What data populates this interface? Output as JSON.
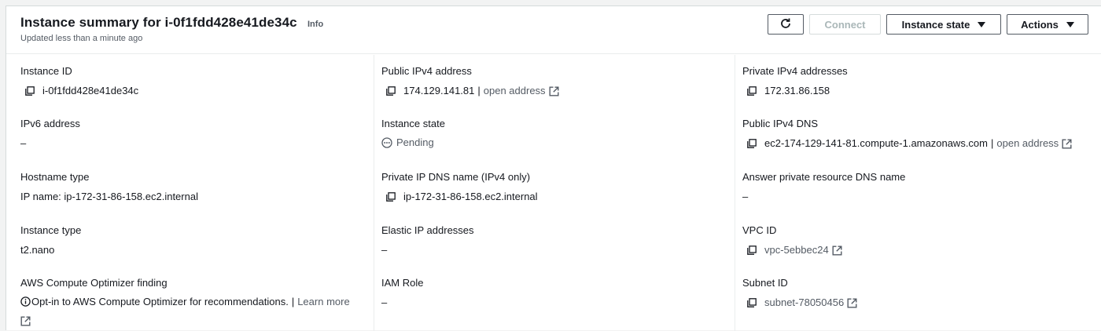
{
  "header": {
    "title": "Instance summary for i-0f1fdd428e41de34c",
    "info": "Info",
    "subtitle": "Updated less than a minute ago",
    "buttons": {
      "connect": "Connect",
      "instance_state": "Instance state",
      "actions": "Actions"
    }
  },
  "fields": {
    "instance_id": {
      "label": "Instance ID",
      "value": "i-0f1fdd428e41de34c"
    },
    "ipv6": {
      "label": "IPv6 address",
      "value": "–"
    },
    "hostname_type": {
      "label": "Hostname type",
      "value": "IP name: ip-172-31-86-158.ec2.internal"
    },
    "instance_type": {
      "label": "Instance type",
      "value": "t2.nano"
    },
    "optimizer": {
      "label": "AWS Compute Optimizer finding",
      "value": "Opt-in to AWS Compute Optimizer for recommendations.",
      "sep": "|",
      "link": "Learn more"
    },
    "public_ipv4": {
      "label": "Public IPv4 address",
      "value": "174.129.141.81",
      "sep": "|",
      "link": "open address"
    },
    "instance_state": {
      "label": "Instance state",
      "value": "Pending"
    },
    "private_dns": {
      "label": "Private IP DNS name (IPv4 only)",
      "value": "ip-172-31-86-158.ec2.internal"
    },
    "elastic_ip": {
      "label": "Elastic IP addresses",
      "value": "–"
    },
    "iam_role": {
      "label": "IAM Role",
      "value": "–"
    },
    "private_ipv4": {
      "label": "Private IPv4 addresses",
      "value": "172.31.86.158"
    },
    "public_dns": {
      "label": "Public IPv4 DNS",
      "value": "ec2-174-129-141-81.compute-1.amazonaws.com",
      "sep": "|",
      "link": "open address"
    },
    "answer_dns": {
      "label": "Answer private resource DNS name",
      "value": "–"
    },
    "vpc_id": {
      "label": "VPC ID",
      "value": "vpc-5ebbec24"
    },
    "subnet_id": {
      "label": "Subnet ID",
      "value": "subnet-78050456"
    }
  },
  "icons": {
    "copy": "copy-icon",
    "external": "external-link-icon",
    "pending": "pending-icon",
    "info": "info-circle-icon",
    "refresh": "refresh-icon"
  },
  "colors": {
    "text": "#16191f",
    "muted": "#545b64",
    "disabled": "#aab7b8"
  }
}
